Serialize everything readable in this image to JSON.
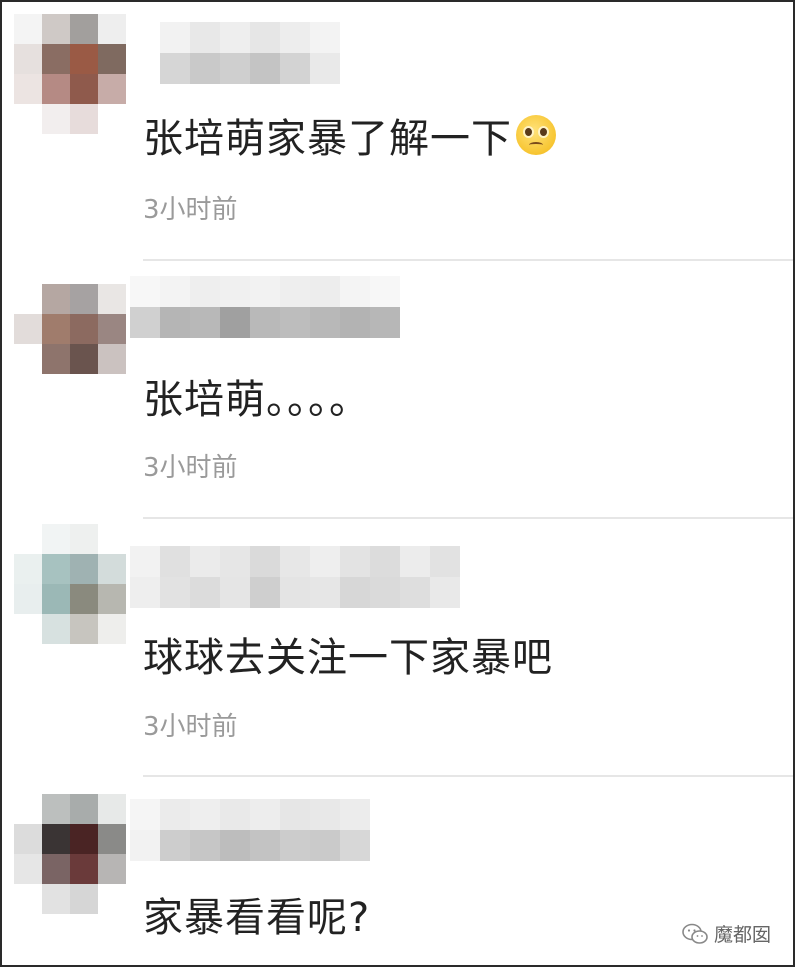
{
  "comments": [
    {
      "text": "张培萌家暴了解一下",
      "emoji": "pleading-face-icon",
      "time": "3小时前",
      "avatar_colors": [
        [
          "#f4f4f4",
          "#cfc9c6",
          "#a29f9d",
          "#eeeeee"
        ],
        [
          "#e6e0de",
          "#8a6d63",
          "#9a5a45",
          "#7f6a60"
        ],
        [
          "#ece4e2",
          "#b58a84",
          "#8f5a4c",
          "#c7aca8"
        ],
        [
          "#ffffff",
          "#f2eeee",
          "#e7dcdb",
          "#ffffff"
        ]
      ],
      "name_colors": [
        [
          "#ffffff",
          "#f2f2f2",
          "#e8e8e8",
          "#eeeeee",
          "#e6e6e6",
          "#ededed",
          "#f3f3f3",
          "#ffffff",
          "#ffffff",
          "#ffffff"
        ],
        [
          "#ffffff",
          "#d6d6d6",
          "#c9c9c9",
          "#cfcfcf",
          "#c4c4c4",
          "#d3d3d3",
          "#e9e9e9",
          "#ffffff",
          "#ffffff",
          "#ffffff"
        ]
      ]
    },
    {
      "text": "张培萌。。。。",
      "emoji": "",
      "time": "3小时前",
      "avatar_colors": [
        [
          "#ffffff",
          "#b5a7a2",
          "#a6a2a2",
          "#e9e6e4"
        ],
        [
          "#e2dcda",
          "#a07c6c",
          "#8c6a60",
          "#9a8682"
        ],
        [
          "#ffffff",
          "#8e746c",
          "#6a544e",
          "#cbc2c0"
        ],
        [
          "#ffffff",
          "#ffffff",
          "#ffffff",
          "#ffffff"
        ]
      ],
      "name_colors": [
        [
          "#f7f7f7",
          "#f3f3f3",
          "#eeeeee",
          "#f0f0f0",
          "#f2f2f2",
          "#eeeeee",
          "#ededed",
          "#f4f4f4",
          "#f7f7f7",
          "#ffffff"
        ],
        [
          "#d0d0d0",
          "#b5b5b5",
          "#b8b8b8",
          "#a0a0a0",
          "#b9b9b9",
          "#bdbdbd",
          "#b8b8b8",
          "#b3b3b3",
          "#b7b7b7",
          "#ffffff"
        ]
      ]
    },
    {
      "text": "球球去关注一下家暴吧",
      "emoji": "",
      "time": "3小时前",
      "avatar_colors": [
        [
          "#ffffff",
          "#f1f4f4",
          "#eef0ef",
          "#ffffff"
        ],
        [
          "#eaf0ef",
          "#a7c2c0",
          "#9fb2b2",
          "#d3dcdb"
        ],
        [
          "#e8eeee",
          "#9bb8b6",
          "#8a8a7e",
          "#b7b7b0"
        ],
        [
          "#ffffff",
          "#d7e1e0",
          "#c7c5bf",
          "#eeeeec"
        ]
      ],
      "name_colors": [
        [
          "#f2f2f2",
          "#e0e0e0",
          "#ebebeb",
          "#e6e6e6",
          "#dadada",
          "#e7e7e7",
          "#eeeeee",
          "#e3e3e3",
          "#dcdcdc",
          "#ececec",
          "#e2e2e2"
        ],
        [
          "#eeeeee",
          "#e2e2e2",
          "#dcdcdc",
          "#e5e5e5",
          "#cfcfcf",
          "#e4e4e4",
          "#e6e6e6",
          "#d7d7d7",
          "#dadada",
          "#dedede",
          "#e9e9e9"
        ]
      ]
    },
    {
      "text": "家暴看看呢?",
      "emoji": "",
      "time": "",
      "avatar_colors": [
        [
          "#ffffff",
          "#bcbfbe",
          "#a8acab",
          "#e7e9e8"
        ],
        [
          "#dcdcdc",
          "#3a3434",
          "#4a2424",
          "#8a8a88"
        ],
        [
          "#e6e6e6",
          "#7a6464",
          "#6a3a3a",
          "#b7b5b4"
        ],
        [
          "#ffffff",
          "#e2e2e2",
          "#d6d6d6",
          "#ffffff"
        ]
      ],
      "name_colors": [
        [
          "#f5f5f5",
          "#ebebeb",
          "#eeeeee",
          "#e9e9e9",
          "#ededed",
          "#e6e6e6",
          "#e8e8e8",
          "#ececec"
        ],
        [
          "#f2f2f2",
          "#cdcdcd",
          "#c6c6c6",
          "#bdbdbd",
          "#c3c3c3",
          "#cccccc",
          "#cacaca",
          "#d7d7d7"
        ]
      ]
    }
  ],
  "watermark": {
    "label": "魔都囡",
    "icon": "wechat-icon"
  }
}
